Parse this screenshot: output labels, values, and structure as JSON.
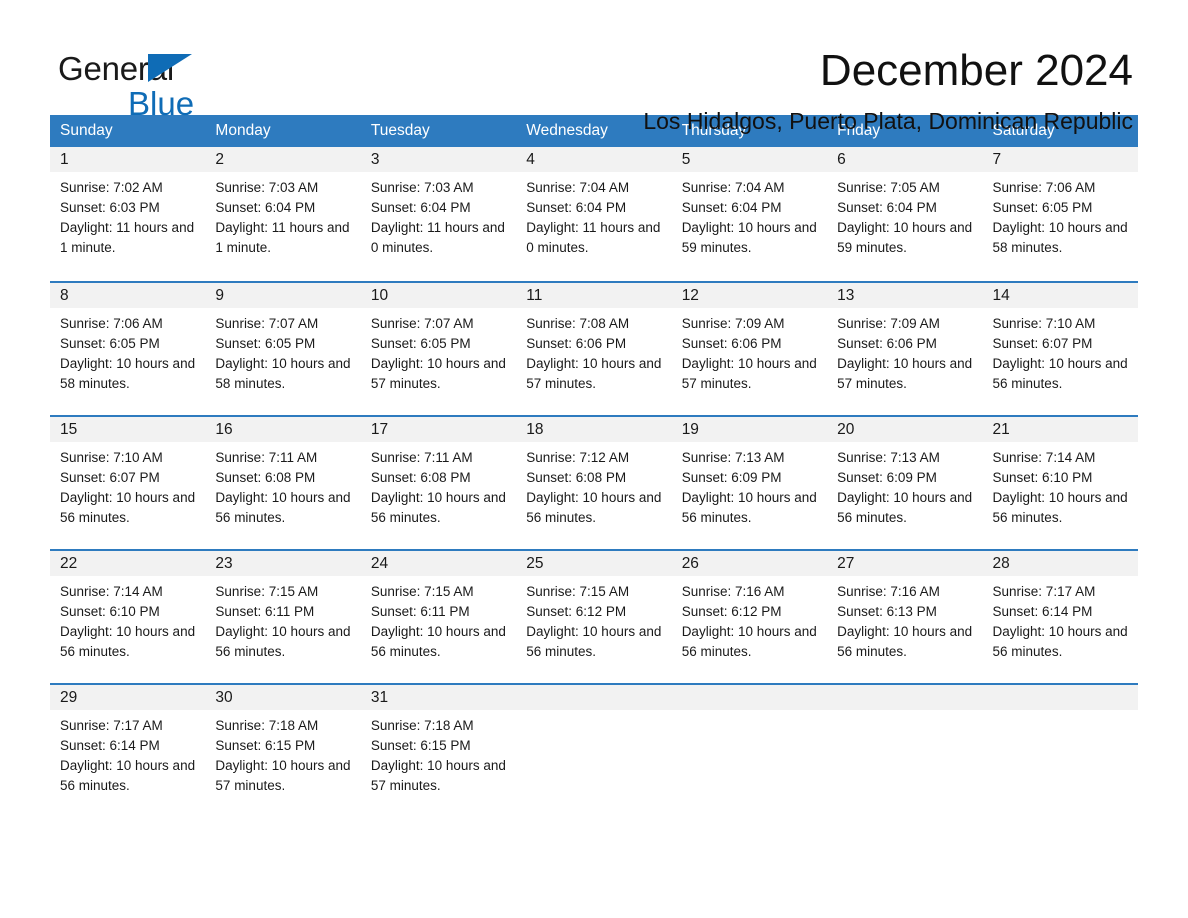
{
  "brand": {
    "name_line1": "General",
    "name_line2": "Blue",
    "accent_color": "#0f6cb6"
  },
  "header": {
    "month_title": "December 2024",
    "location": "Los Hidalgos, Puerto Plata, Dominican Republic"
  },
  "calendar": {
    "header_bg": "#2e7bbf",
    "day_cell_bg": "#f2f2f2",
    "weekdays": [
      "Sunday",
      "Monday",
      "Tuesday",
      "Wednesday",
      "Thursday",
      "Friday",
      "Saturday"
    ],
    "weeks": [
      [
        {
          "day": "1",
          "sunrise": "Sunrise: 7:02 AM",
          "sunset": "Sunset: 6:03 PM",
          "daylight": "Daylight: 11 hours and 1 minute."
        },
        {
          "day": "2",
          "sunrise": "Sunrise: 7:03 AM",
          "sunset": "Sunset: 6:04 PM",
          "daylight": "Daylight: 11 hours and 1 minute."
        },
        {
          "day": "3",
          "sunrise": "Sunrise: 7:03 AM",
          "sunset": "Sunset: 6:04 PM",
          "daylight": "Daylight: 11 hours and 0 minutes."
        },
        {
          "day": "4",
          "sunrise": "Sunrise: 7:04 AM",
          "sunset": "Sunset: 6:04 PM",
          "daylight": "Daylight: 11 hours and 0 minutes."
        },
        {
          "day": "5",
          "sunrise": "Sunrise: 7:04 AM",
          "sunset": "Sunset: 6:04 PM",
          "daylight": "Daylight: 10 hours and 59 minutes."
        },
        {
          "day": "6",
          "sunrise": "Sunrise: 7:05 AM",
          "sunset": "Sunset: 6:04 PM",
          "daylight": "Daylight: 10 hours and 59 minutes."
        },
        {
          "day": "7",
          "sunrise": "Sunrise: 7:06 AM",
          "sunset": "Sunset: 6:05 PM",
          "daylight": "Daylight: 10 hours and 58 minutes."
        }
      ],
      [
        {
          "day": "8",
          "sunrise": "Sunrise: 7:06 AM",
          "sunset": "Sunset: 6:05 PM",
          "daylight": "Daylight: 10 hours and 58 minutes."
        },
        {
          "day": "9",
          "sunrise": "Sunrise: 7:07 AM",
          "sunset": "Sunset: 6:05 PM",
          "daylight": "Daylight: 10 hours and 58 minutes."
        },
        {
          "day": "10",
          "sunrise": "Sunrise: 7:07 AM",
          "sunset": "Sunset: 6:05 PM",
          "daylight": "Daylight: 10 hours and 57 minutes."
        },
        {
          "day": "11",
          "sunrise": "Sunrise: 7:08 AM",
          "sunset": "Sunset: 6:06 PM",
          "daylight": "Daylight: 10 hours and 57 minutes."
        },
        {
          "day": "12",
          "sunrise": "Sunrise: 7:09 AM",
          "sunset": "Sunset: 6:06 PM",
          "daylight": "Daylight: 10 hours and 57 minutes."
        },
        {
          "day": "13",
          "sunrise": "Sunrise: 7:09 AM",
          "sunset": "Sunset: 6:06 PM",
          "daylight": "Daylight: 10 hours and 57 minutes."
        },
        {
          "day": "14",
          "sunrise": "Sunrise: 7:10 AM",
          "sunset": "Sunset: 6:07 PM",
          "daylight": "Daylight: 10 hours and 56 minutes."
        }
      ],
      [
        {
          "day": "15",
          "sunrise": "Sunrise: 7:10 AM",
          "sunset": "Sunset: 6:07 PM",
          "daylight": "Daylight: 10 hours and 56 minutes."
        },
        {
          "day": "16",
          "sunrise": "Sunrise: 7:11 AM",
          "sunset": "Sunset: 6:08 PM",
          "daylight": "Daylight: 10 hours and 56 minutes."
        },
        {
          "day": "17",
          "sunrise": "Sunrise: 7:11 AM",
          "sunset": "Sunset: 6:08 PM",
          "daylight": "Daylight: 10 hours and 56 minutes."
        },
        {
          "day": "18",
          "sunrise": "Sunrise: 7:12 AM",
          "sunset": "Sunset: 6:08 PM",
          "daylight": "Daylight: 10 hours and 56 minutes."
        },
        {
          "day": "19",
          "sunrise": "Sunrise: 7:13 AM",
          "sunset": "Sunset: 6:09 PM",
          "daylight": "Daylight: 10 hours and 56 minutes."
        },
        {
          "day": "20",
          "sunrise": "Sunrise: 7:13 AM",
          "sunset": "Sunset: 6:09 PM",
          "daylight": "Daylight: 10 hours and 56 minutes."
        },
        {
          "day": "21",
          "sunrise": "Sunrise: 7:14 AM",
          "sunset": "Sunset: 6:10 PM",
          "daylight": "Daylight: 10 hours and 56 minutes."
        }
      ],
      [
        {
          "day": "22",
          "sunrise": "Sunrise: 7:14 AM",
          "sunset": "Sunset: 6:10 PM",
          "daylight": "Daylight: 10 hours and 56 minutes."
        },
        {
          "day": "23",
          "sunrise": "Sunrise: 7:15 AM",
          "sunset": "Sunset: 6:11 PM",
          "daylight": "Daylight: 10 hours and 56 minutes."
        },
        {
          "day": "24",
          "sunrise": "Sunrise: 7:15 AM",
          "sunset": "Sunset: 6:11 PM",
          "daylight": "Daylight: 10 hours and 56 minutes."
        },
        {
          "day": "25",
          "sunrise": "Sunrise: 7:15 AM",
          "sunset": "Sunset: 6:12 PM",
          "daylight": "Daylight: 10 hours and 56 minutes."
        },
        {
          "day": "26",
          "sunrise": "Sunrise: 7:16 AM",
          "sunset": "Sunset: 6:12 PM",
          "daylight": "Daylight: 10 hours and 56 minutes."
        },
        {
          "day": "27",
          "sunrise": "Sunrise: 7:16 AM",
          "sunset": "Sunset: 6:13 PM",
          "daylight": "Daylight: 10 hours and 56 minutes."
        },
        {
          "day": "28",
          "sunrise": "Sunrise: 7:17 AM",
          "sunset": "Sunset: 6:14 PM",
          "daylight": "Daylight: 10 hours and 56 minutes."
        }
      ],
      [
        {
          "day": "29",
          "sunrise": "Sunrise: 7:17 AM",
          "sunset": "Sunset: 6:14 PM",
          "daylight": "Daylight: 10 hours and 56 minutes."
        },
        {
          "day": "30",
          "sunrise": "Sunrise: 7:18 AM",
          "sunset": "Sunset: 6:15 PM",
          "daylight": "Daylight: 10 hours and 57 minutes."
        },
        {
          "day": "31",
          "sunrise": "Sunrise: 7:18 AM",
          "sunset": "Sunset: 6:15 PM",
          "daylight": "Daylight: 10 hours and 57 minutes."
        },
        {
          "day": "",
          "sunrise": "",
          "sunset": "",
          "daylight": ""
        },
        {
          "day": "",
          "sunrise": "",
          "sunset": "",
          "daylight": ""
        },
        {
          "day": "",
          "sunrise": "",
          "sunset": "",
          "daylight": ""
        },
        {
          "day": "",
          "sunrise": "",
          "sunset": "",
          "daylight": ""
        }
      ]
    ]
  }
}
